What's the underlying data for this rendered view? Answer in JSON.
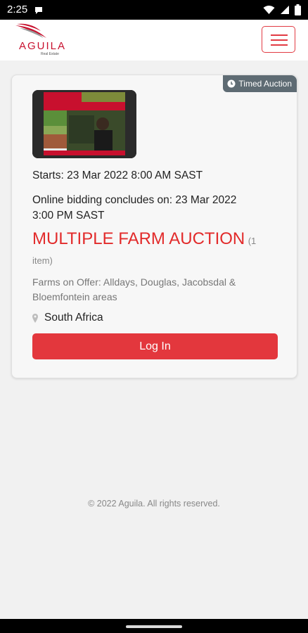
{
  "status_bar": {
    "time": "2:25",
    "icons": [
      "notification-icon",
      "wifi-icon",
      "signal-icon",
      "battery-icon"
    ]
  },
  "header": {
    "logo_name": "AGUILA",
    "logo_sub": "Real Estate",
    "menu_icon": "hamburger-icon",
    "accent_color": "#e23b43"
  },
  "listing": {
    "badge": "Timed Auction",
    "starts": "Starts: 23 Mar 2022 8:00 AM SAST",
    "concludes_line1": "Online bidding concludes on: 23 Mar 2022",
    "concludes_line2": "3:00 PM SAST",
    "title": "MULTIPLE FARM AUCTION",
    "item_count": "(1 item)",
    "description": "Farms on Offer: Alldays, Douglas, Jacobsdal & Bloemfontein areas",
    "location": "South Africa",
    "login_label": "Log In",
    "title_color": "#e22b2b",
    "button_color": "#e3373d",
    "badge_color": "#5e6b73"
  },
  "footer": {
    "copyright": "© 2022 Aguila. All rights reserved."
  }
}
